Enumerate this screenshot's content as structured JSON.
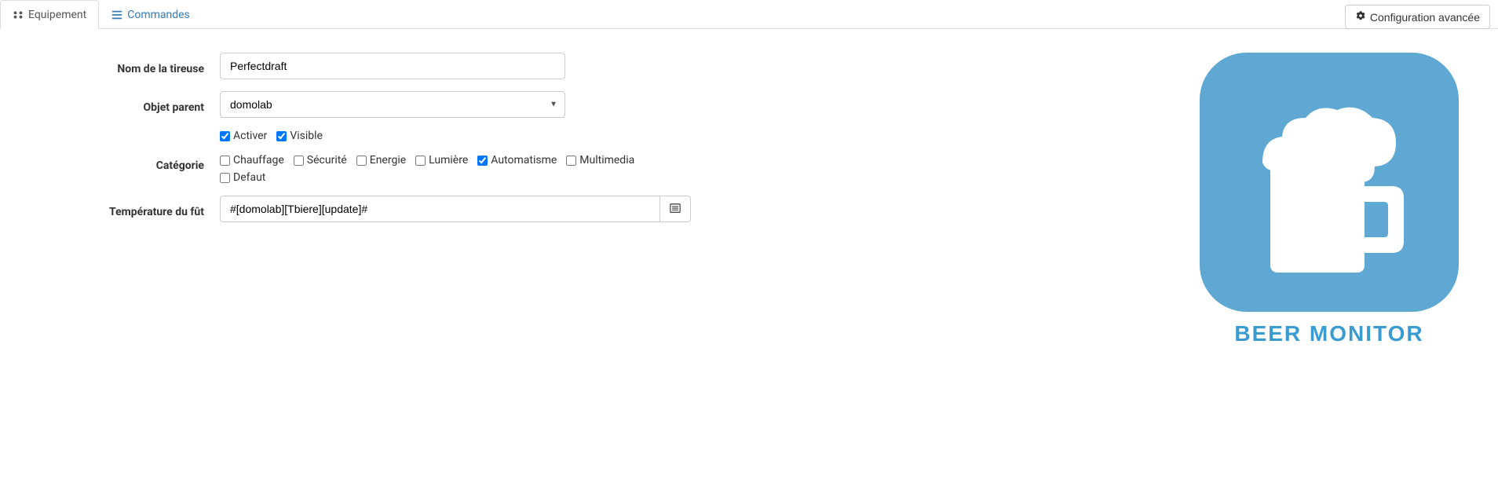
{
  "tabs": {
    "equipment": "Equipement",
    "commands": "Commandes"
  },
  "config_button": "Configuration avancée",
  "form": {
    "name_label": "Nom de la tireuse",
    "name_value": "Perfectdraft",
    "parent_label": "Objet parent",
    "parent_value": "domolab",
    "activate_label": "Activer",
    "visible_label": "Visible",
    "category_label": "Catégorie",
    "categories": {
      "heating": "Chauffage",
      "security": "Sécurité",
      "energy": "Energie",
      "light": "Lumière",
      "automation": "Automatisme",
      "multimedia": "Multimedia",
      "default": "Defaut"
    },
    "temperature_label": "Température du fût",
    "temperature_value": "#[domolab][Tbiere][update]#"
  },
  "logo": {
    "text": "BEER MONITOR"
  }
}
